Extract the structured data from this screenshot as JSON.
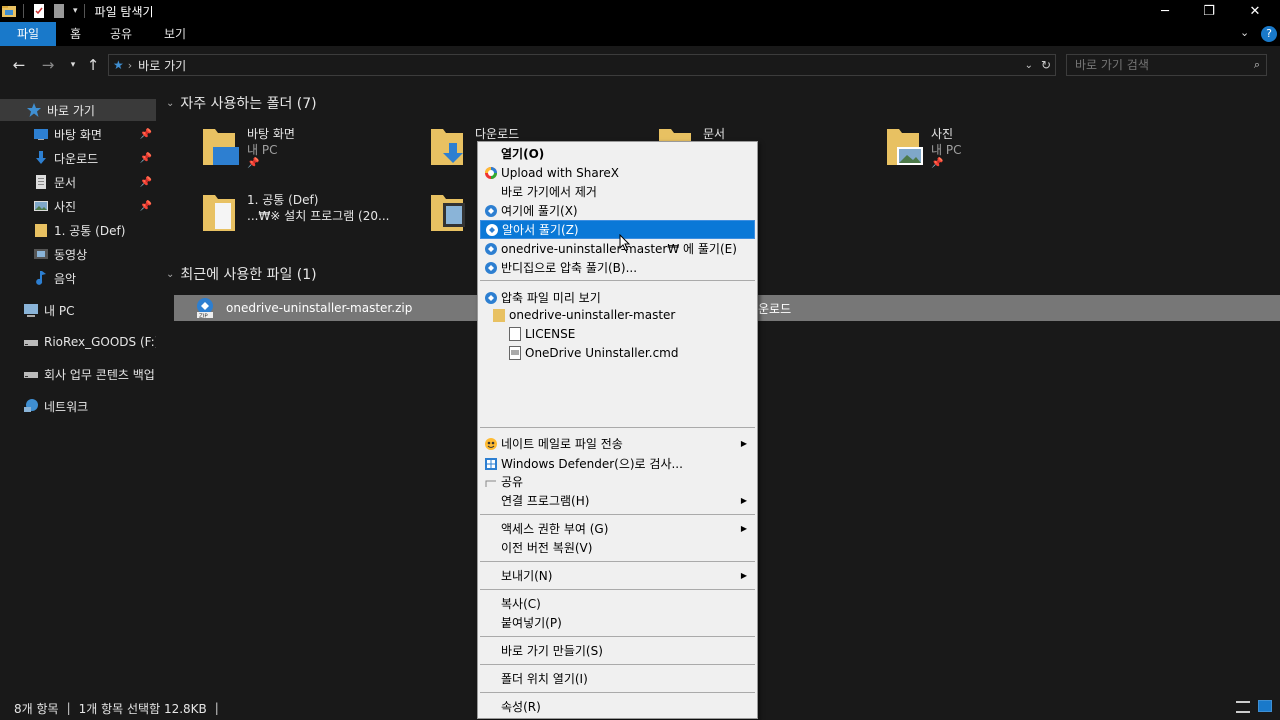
{
  "window": {
    "title": "파일 탐색기",
    "controls": {
      "minimize": "─",
      "maximize": "❐",
      "close": "✕"
    }
  },
  "ribbon": {
    "tabs": [
      "파일",
      "홈",
      "공유",
      "보기"
    ],
    "active": 0
  },
  "address": {
    "crumb": "바로 가기",
    "search_placeholder": "바로 가기 검색"
  },
  "sidebar": {
    "items": [
      {
        "label": "바로 가기",
        "icon": "star-icon",
        "pinned": false
      },
      {
        "label": "바탕 화면",
        "icon": "desktop-icon",
        "pinned": true
      },
      {
        "label": "다운로드",
        "icon": "download-icon",
        "pinned": true
      },
      {
        "label": "문서",
        "icon": "document-icon",
        "pinned": true
      },
      {
        "label": "사진",
        "icon": "pictures-icon",
        "pinned": true
      },
      {
        "label": "1. 공통 (Def)",
        "icon": "folder-icon",
        "pinned": false
      },
      {
        "label": "동영상",
        "icon": "video-icon",
        "pinned": false
      },
      {
        "label": "음악",
        "icon": "music-icon",
        "pinned": false
      },
      {
        "label": "내 PC",
        "icon": "pc-icon",
        "pinned": false
      },
      {
        "label": "RioRex_GOODS (F:)",
        "icon": "drive-icon",
        "pinned": false
      },
      {
        "label": "회사 업무 콘텐츠 백업",
        "icon": "drive-icon",
        "pinned": false
      },
      {
        "label": "네트워크",
        "icon": "network-icon",
        "pinned": false
      }
    ]
  },
  "frequent": {
    "heading": "자주 사용하는 폴더 (7)",
    "tiles": [
      {
        "name": "바탕 화면",
        "sub": "내 PC",
        "icon": "desktop-folder-icon",
        "pinned": true
      },
      {
        "name": "다운로드",
        "sub": "",
        "icon": "download-folder-icon",
        "pinned": false
      },
      {
        "name": "문서",
        "sub": "",
        "icon": "documents-folder-icon",
        "pinned": false
      },
      {
        "name": "사진",
        "sub": "내 PC",
        "icon": "pictures-folder-icon",
        "pinned": true
      },
      {
        "name": "1. 공통 (Def)",
        "sub": "...₩※ 설치 프로그램 (20...",
        "icon": "folder-icon",
        "pinned": false
      },
      {
        "name": "",
        "sub": "",
        "icon": "video-folder-icon",
        "pinned": false
      }
    ]
  },
  "recent": {
    "heading": "최근에 사용한 파일 (1)",
    "file_name": "onedrive-uninstaller-master.zip",
    "file_location": "운로드"
  },
  "status": {
    "count": "8개 항목",
    "selection": "1개 항목 선택함 12.8KB"
  },
  "context_menu": {
    "open": "열기(O)",
    "sharex": "Upload with ShareX",
    "remove_quick": "바로 가기에서 제거",
    "extract_here": "여기에 풀기(X)",
    "extract_smart": "알아서 풀기(Z)",
    "extract_to": "onedrive-uninstaller-master₩ 에 풀기(E)",
    "extract_bandizip": "반디집으로 압축 풀기(B)...",
    "preview": "압축 파일 미리 보기",
    "tree_folder": "onedrive-uninstaller-master",
    "tree_file1": "LICENSE",
    "tree_file2": "OneDrive Uninstaller.cmd",
    "mail": "네이트 메일로 파일 전송",
    "defender": "Windows Defender(으)로 검사...",
    "share": "공유",
    "open_with": "연결 프로그램(H)",
    "access": "액세스 권한 부여 (G)",
    "restore": "이전 버전 복원(V)",
    "send_to": "보내기(N)",
    "copy": "복사(C)",
    "paste": "붙여넣기(P)",
    "create_shortcut": "바로 가기 만들기(S)",
    "open_location": "폴더 위치 열기(I)",
    "properties": "속성(R)"
  },
  "colors": {
    "accent": "#1979ca",
    "menu_highlight": "#0a78d7",
    "folder": "#e8c162"
  }
}
